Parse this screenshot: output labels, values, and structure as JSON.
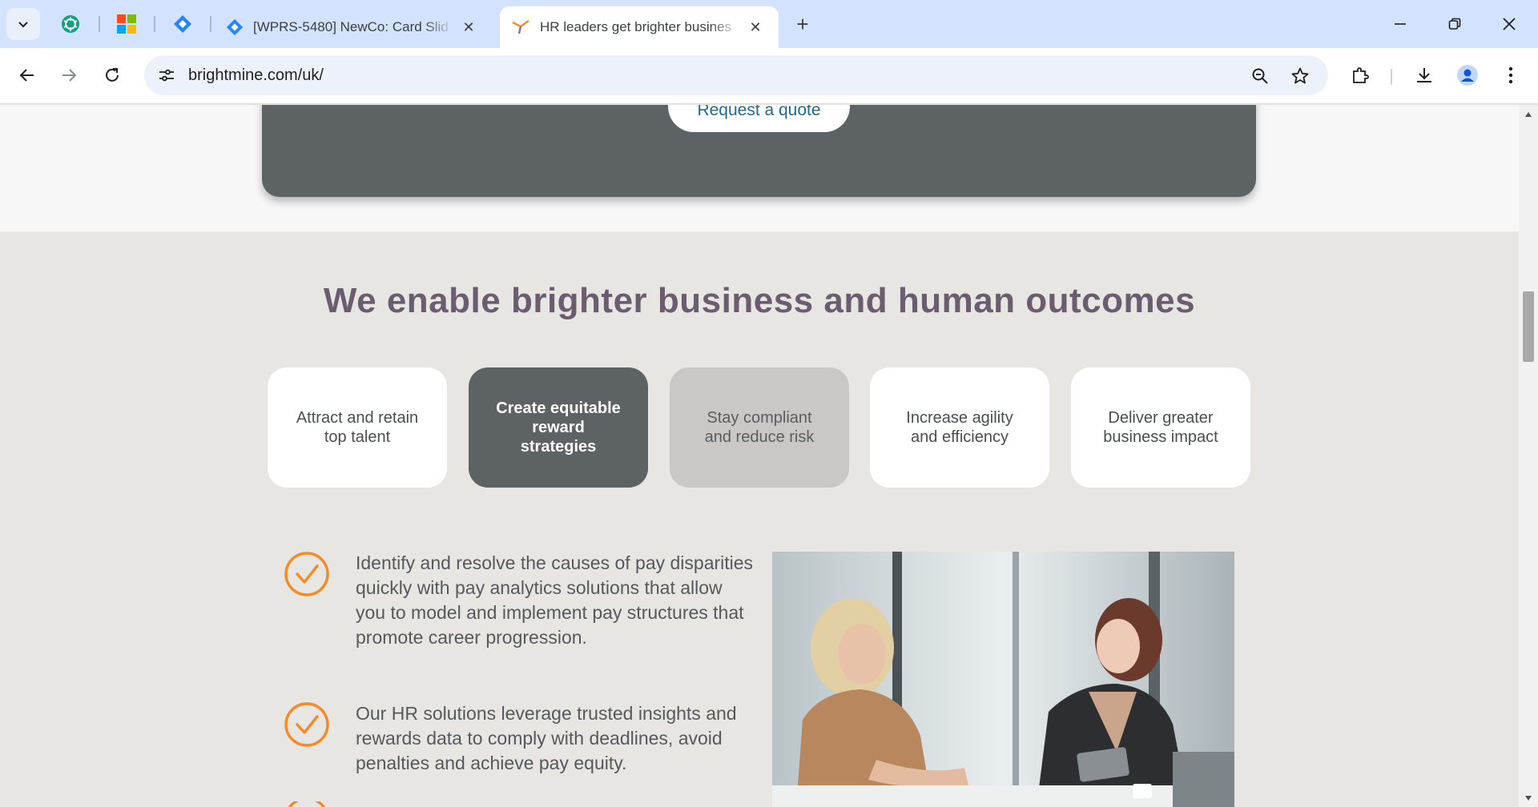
{
  "browser": {
    "tabs": [
      {
        "title": "[WPRS-5480] NewCo: Card Slid",
        "icon": "jira-diamond-icon"
      },
      {
        "title": "HR leaders get brighter busines",
        "icon": "brightmine-logo-icon"
      }
    ],
    "pinned_tabs": [
      "chatgpt-icon",
      "microsoft-icon",
      "jira-diamond-icon"
    ],
    "url": "brightmine.com/uk/",
    "accent_color": "#d3e3fd"
  },
  "page": {
    "cta_button": "Request a quote",
    "headline": "We enable brighter business and human outcomes",
    "cards": [
      {
        "label": "Attract and retain top talent",
        "state": "default"
      },
      {
        "label": "Create equitable reward strategies",
        "state": "selected"
      },
      {
        "label": "Stay compliant and reduce risk",
        "state": "hover"
      },
      {
        "label": "Increase agility and efficiency",
        "state": "default"
      },
      {
        "label": "Deliver greater business impact",
        "state": "default"
      }
    ],
    "bullets": [
      "Identify and resolve the causes of pay disparities quickly with pay analytics solutions that allow you to model and implement pay structures that promote career progression.",
      "Our HR solutions leverage trusted insights and rewards data to comply with deadlines, avoid penalties and achieve pay equity."
    ],
    "colors": {
      "check_orange": "#f28c28",
      "selected_card": "#5d6265",
      "headline": "#6b5d70",
      "link_blue": "#1e6b8f"
    }
  }
}
